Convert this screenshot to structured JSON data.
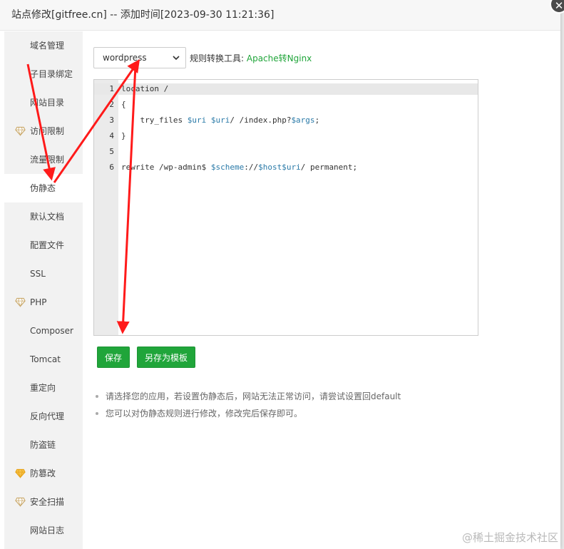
{
  "window": {
    "title": "站点修改[gitfree.cn] -- 添加时间[2023-09-30 11:21:36]",
    "close_icon": "close-icon"
  },
  "sidebar": {
    "items": [
      {
        "label": "域名管理",
        "icon": null,
        "active": false
      },
      {
        "label": "子目录绑定",
        "icon": null,
        "active": false
      },
      {
        "label": "网站目录",
        "icon": null,
        "active": false
      },
      {
        "label": "访问限制",
        "icon": "gem-icon",
        "active": false
      },
      {
        "label": "流量限制",
        "icon": null,
        "active": false
      },
      {
        "label": "伪静态",
        "icon": null,
        "active": true
      },
      {
        "label": "默认文档",
        "icon": null,
        "active": false
      },
      {
        "label": "配置文件",
        "icon": null,
        "active": false
      },
      {
        "label": "SSL",
        "icon": null,
        "active": false
      },
      {
        "label": "PHP",
        "icon": "gem-icon",
        "active": false
      },
      {
        "label": "Composer",
        "icon": null,
        "active": false
      },
      {
        "label": "Tomcat",
        "icon": null,
        "active": false
      },
      {
        "label": "重定向",
        "icon": null,
        "active": false
      },
      {
        "label": "反向代理",
        "icon": null,
        "active": false
      },
      {
        "label": "防盗链",
        "icon": null,
        "active": false
      },
      {
        "label": "防篡改",
        "icon": "gem-icon-gold",
        "active": false
      },
      {
        "label": "安全扫描",
        "icon": "gem-icon",
        "active": false
      },
      {
        "label": "网站日志",
        "icon": null,
        "active": false
      }
    ]
  },
  "rewrite": {
    "template_select_value": "wordpress",
    "tool_label": "规则转换工具:",
    "tool_link": "Apache转Nginx"
  },
  "editor": {
    "lines": [
      {
        "num": "1",
        "text": "location /"
      },
      {
        "num": "2",
        "text": "{"
      },
      {
        "num": "3",
        "text": "    try_files $uri $uri/ /index.php?$args;"
      },
      {
        "num": "4",
        "text": "}"
      },
      {
        "num": "5",
        "text": ""
      },
      {
        "num": "6",
        "text": "rewrite /wp-admin$ $scheme://$host$uri/ permanent;"
      }
    ]
  },
  "buttons": {
    "save": "保存",
    "save_as_template": "另存为模板"
  },
  "tips": [
    "请选择您的应用，若设置伪静态后，网站无法正常访问，请尝试设置回default",
    "您可以对伪静态规则进行修改，修改完后保存即可。"
  ],
  "watermark": "@稀土掘金技术社区",
  "colors": {
    "accent": "#20a53a",
    "annotation_arrow": "#ff1a1a"
  }
}
